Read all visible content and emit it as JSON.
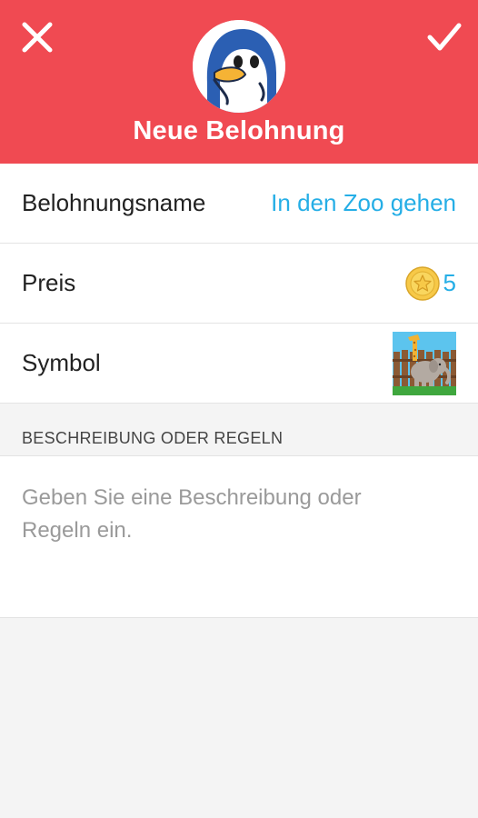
{
  "header": {
    "title": "Neue Belohnung",
    "close_icon": "close-icon",
    "confirm_icon": "checkmark-icon",
    "avatar_icon": "penguin-avatar",
    "background_color": "#f04a52"
  },
  "rows": {
    "name": {
      "label": "Belohnungsname",
      "value": "In den Zoo gehen"
    },
    "price": {
      "label": "Preis",
      "value": "5",
      "icon": "star-coin-icon"
    },
    "symbol": {
      "label": "Symbol",
      "icon": "zoo-elephant-giraffe-icon"
    }
  },
  "description": {
    "section_title": "BESCHREIBUNG ODER REGELN",
    "placeholder": "Geben Sie eine Beschreibung oder Regeln ein."
  },
  "colors": {
    "accent": "#25aee6",
    "header": "#f04a52"
  }
}
